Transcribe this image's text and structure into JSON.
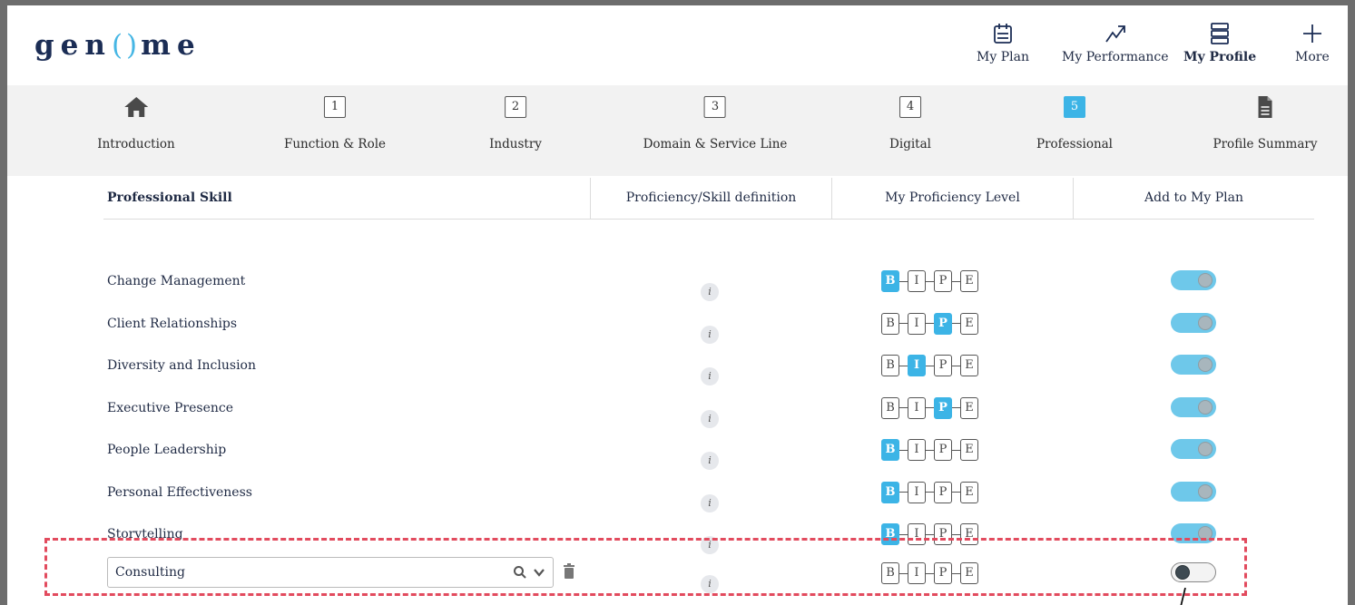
{
  "logo": {
    "pre": "gen",
    "mid": "()",
    "post": "me"
  },
  "nav": {
    "plan_label": "My Plan",
    "performance_label": "My Performance",
    "profile_label": "My Profile",
    "more_label": "More"
  },
  "steps": [
    {
      "label": "Introduction",
      "icon": "home-icon"
    },
    {
      "label": "Function & Role",
      "num": "1"
    },
    {
      "label": "Industry",
      "num": "2"
    },
    {
      "label": "Domain & Service Line",
      "num": "3"
    },
    {
      "label": "Digital",
      "num": "4"
    },
    {
      "label": "Professional",
      "num": "5",
      "current": true
    },
    {
      "label": "Profile Summary",
      "icon": "document-icon"
    }
  ],
  "table": {
    "col_skill": "Professional Skill",
    "col_definition": "Proficiency/Skill definition",
    "col_level": "My Proficiency Level",
    "col_plan": "Add to My Plan"
  },
  "level_letters": [
    "B",
    "I",
    "P",
    "E"
  ],
  "info_glyph": "i",
  "rows": [
    {
      "skill": "Change Management",
      "level": "B",
      "in_plan": true
    },
    {
      "skill": "Client Relationships",
      "level": "P",
      "in_plan": true
    },
    {
      "skill": "Diversity and Inclusion",
      "level": "I",
      "in_plan": true
    },
    {
      "skill": "Executive Presence",
      "level": "P",
      "in_plan": true
    },
    {
      "skill": "People Leadership",
      "level": "B",
      "in_plan": true
    },
    {
      "skill": "Personal Effectiveness",
      "level": "B",
      "in_plan": true
    },
    {
      "skill": "Storytelling",
      "level": "B",
      "in_plan": true
    }
  ],
  "new_row": {
    "skill_value": "Consulting",
    "level": null,
    "in_plan": false
  },
  "colors": {
    "accent": "#3cb4e6",
    "toggle_on": "#6ec8ea",
    "highlight": "#e24b5e",
    "brand_dark": "#1b2d55"
  }
}
